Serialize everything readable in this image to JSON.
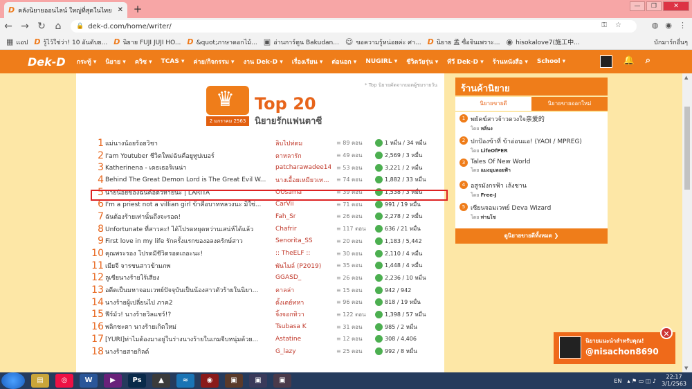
{
  "browser": {
    "tab_title": "คลังนิยายออนไลน์ ใหญ่ที่สุดในไทย",
    "url": "dek-d.com/home/writer/",
    "bookmarks": [
      {
        "label": "แอป"
      },
      {
        "label": "รู้ไว้ใช่ว่า! 10 อันดับย..."
      },
      {
        "label": "นิยาย FUJI JUJI HO..."
      },
      {
        "label": "&quot;ภาษาดอกไม้..."
      },
      {
        "label": "อ่านการ์ตูน Bakudan..."
      },
      {
        "label": "ขอความรู้หน่อยค่ะ ศา..."
      },
      {
        "label": "นิยาย 孟 ซื่อจินเพราะ..."
      },
      {
        "label": "hisokalove7(施工中..."
      }
    ],
    "bookmarks_other": "บักมาร์กอื่นๆ"
  },
  "site_nav": {
    "logo": "Dek-D",
    "items": [
      "กระทู้ ▾",
      "นิยาย ▾",
      "ควิซ ▾",
      "TCAS ▾",
      "ค่าย/กิจกรรม ▾",
      "งาน Dek-D ▾",
      "เรื่องเรียน ▾",
      "ต่อนอก ▾",
      "NUGIRL ▾",
      "ชีวิตวัยรุ่น ▾",
      "ทีวี Dek-D ▾",
      "ร้านหนังสือ ▾",
      "School ▾"
    ]
  },
  "ranking": {
    "note": "* Top นิยายคัดจากยอดผู้ชมรายวัน",
    "date": "2 มกราคม 2563",
    "title": "Top 20",
    "subtitle": "นิยายรักแฟนตาซี",
    "rows": [
      {
        "rank": "1",
        "title": "แม่นางน้อยร้อยวิชา",
        "author": "ลิบไปท่ตม",
        "eps": "89 ตอน",
        "views": "1 หมื่น / 34 หมื่น"
      },
      {
        "rank": "2",
        "title": "I'am Youtuber ชีวิตใหม่ฉันคือยูทูปเบอร์",
        "author": "ดาหลารัก",
        "eps": "49 ตอน",
        "views": "2,569 / 3 หมื่น"
      },
      {
        "rank": "3",
        "title": "Katherinena - เดธเธอริเนน่า",
        "author": "patcharawadee14",
        "eps": "53 ตอน",
        "views": "3,221 / 2 หมื่น"
      },
      {
        "rank": "4",
        "title": "Behind The Great Demon Lord is The Great Evil W...",
        "author": "นางเอื้อยเหมียวเท...",
        "eps": "74 ตอน",
        "views": "1,882 / 33 หมื่น"
      },
      {
        "rank": "5",
        "title": "นายน้อยของฉันคือตัวหายนะ | LARITA",
        "author": "OUsama",
        "eps": "39 ตอน",
        "views": "1,538 / 3 หมื่น"
      },
      {
        "rank": "6",
        "title": "I'm a priest not a villian girl ข้าคือบาทหลวงนะ มิใช่...",
        "author": "CarVii",
        "eps": "71 ตอน",
        "views": "991 / 19 หมื่น"
      },
      {
        "rank": "7",
        "title": "ฉันต้องร้ายเท่านั้นถึงจะรอด!",
        "author": "Fah_Sr",
        "eps": "26 ตอน",
        "views": "2,278 / 2 หมื่น"
      },
      {
        "rank": "8",
        "title": "Unfortunate ที่สาวคะ! ได้โปรดหยุดหว่านเสน่ห์ได้แล้ว",
        "author": "Chafrir",
        "eps": "117 ตอน",
        "views": "636 / 21 หมื่น"
      },
      {
        "rank": "9",
        "title": "First love in my life รักครั้งแรกของอลงครักษ์สาว",
        "author": "Senorita_SS",
        "eps": "20 ตอน",
        "views": "1,183 / 5,442"
      },
      {
        "rank": "10",
        "title": "คุณพระรอง โปรดมีชีวิตรอดเถอะนะ!",
        "author": ":: TheELF ::",
        "eps": "30 ตอน",
        "views": "2,110 / 4 หมื่น"
      },
      {
        "rank": "11",
        "title": "เมียจี จารชนสาวข้ามภพ",
        "author": "พันไมล์ (P2019)",
        "eps": "35 ตอน",
        "views": "1,448 / 4 หมื่น"
      },
      {
        "rank": "12",
        "title": "ลูเซียนางร้ายไร้เสียง",
        "author": "GGASD_",
        "eps": "26 ตอน",
        "views": "2,236 / 10 หมื่น"
      },
      {
        "rank": "13",
        "title": "อดีตเป็นมหาจอมเวทย์ปัจจุบันเป็นน้องสาวตัวร้ายในนิยา...",
        "author": "คาลล่า",
        "eps": "15 ตอน",
        "views": "942 / 942"
      },
      {
        "rank": "14",
        "title": "นางร้ายผู้เปลี่ยนไป ภาค2",
        "author": "ดั้งเดย์ทหา",
        "eps": "96 ตอน",
        "views": "818 / 19 หมื่น"
      },
      {
        "rank": "15",
        "title": "ฟีร์มัว! นางร้ายวิลแชร์!?",
        "author": "จิ้งจอกทิวา",
        "eps": "122 ตอน",
        "views": "1,398 / 57 หมื่น"
      },
      {
        "rank": "16",
        "title": "พลิกชะตา นางร้ายเกิดใหม่",
        "author": "Tsubasa K",
        "eps": "31 ตอน",
        "views": "985 / 2 หมื่น"
      },
      {
        "rank": "17",
        "title": "[YURI]ท่าไมต้องมาอยู่ในร่างนางร้ายในเกมจีบหนุ่มด้วย...",
        "author": "Astatine",
        "eps": "12 ตอน",
        "views": "308 / 4,406"
      },
      {
        "rank": "18",
        "title": "นางร้ายสายกิลด์",
        "author": "G_lazy",
        "eps": "25 ตอน",
        "views": "992 / 8 หมื่น"
      }
    ]
  },
  "shop": {
    "title": "ร้านค้านิยาย",
    "tabs": [
      "นิยายขายดี",
      "นิยายขายออกใหม่"
    ],
    "items": [
      {
        "num": "1",
        "title": "พยัคฆ์สาวจ้าวดวงใจ亲爱的",
        "by": "โดย",
        "author": "หลิ่นง"
      },
      {
        "num": "2",
        "title": "ปกป้องข้าที่ ข้าอ่อนแอ! (YAOI / MPREG)",
        "by": "โดย",
        "author": "LifeOfPER"
      },
      {
        "num": "3",
        "title": "Tales Of New World",
        "by": "โดย",
        "author": "แมงมุมลอยฟ้า"
      },
      {
        "num": "4",
        "title": "อสูรมังกรฟ้า เล้งซาน",
        "by": "โดย",
        "author": "Free-J"
      },
      {
        "num": "5",
        "title": "เซียนจอมเวทย์ Deva Wizard",
        "by": "โดย",
        "author": "ท่านโช"
      }
    ],
    "all_label": "ดูนิยายขายดีทั้งหมด ❯"
  },
  "reco": {
    "line1": "นิยายแนะนำสำหรับคุณ!",
    "line2": "@nisachon8690"
  },
  "taskbar": {
    "lang": "EN",
    "time": "22:17",
    "date": "3/1/2563"
  }
}
